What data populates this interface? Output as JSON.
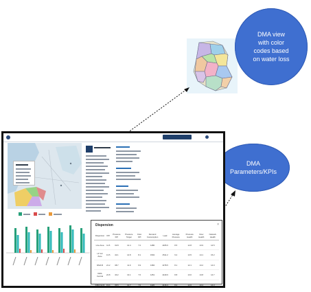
{
  "callouts": {
    "top": "DMA view\nwith color\ncodes based\non water loss",
    "mid": "DMA\nParameters/KPIs"
  },
  "colors": {
    "callout": "#3f6fd0",
    "accent": "#1f3f6a",
    "bar_green": "#27a07a",
    "bar_teal": "#2fb9b9",
    "bar_red": "#d94b4b",
    "bar_orange": "#e99a3b"
  },
  "icons": [
    "dma-map-icon",
    "arrow-icon",
    "chart-icon"
  ],
  "table": {
    "title": "Dispersion",
    "close": "×",
    "columns": [
      "Dispersion",
      "KPI",
      "Pressure\nKPI",
      "Pressure\nTarget",
      "Flow\nKPI",
      "Demand\nConsumption",
      "Leak",
      "Average\nPressure",
      "Pressure\nHealth",
      "Flow\nHealth",
      "Network\nHealth"
    ],
    "rows": [
      [
        "Line Area",
        "11.5",
        "32.8",
        "12.4",
        "7.2",
        "1480",
        "1465.6",
        "8.5",
        "12.8",
        "13.9",
        "14.5"
      ],
      [
        "LP 1/2 Zone",
        "13.5",
        "42.1",
        "14.8",
        "8.1",
        "1502",
        "1511.2",
        "9.2",
        "13.5",
        "14.1",
        "15.2"
      ],
      [
        "DMA B",
        "21.2",
        "38.7",
        "11.9",
        "6.9",
        "1384",
        "1378.5",
        "8.1",
        "12.1",
        "13.2",
        "14.0"
      ],
      [
        "DMA Central",
        "22.8",
        "40.2",
        "13.1",
        "7.6",
        "1451",
        "1449.9",
        "8.8",
        "13.0",
        "13.8",
        "14.7"
      ],
      [
        "DMA North",
        "19.4",
        "36.5",
        "12.7",
        "7.0",
        "1420",
        "1416.3",
        "8.4",
        "12.6",
        "13.4",
        "14.3"
      ]
    ]
  }
}
